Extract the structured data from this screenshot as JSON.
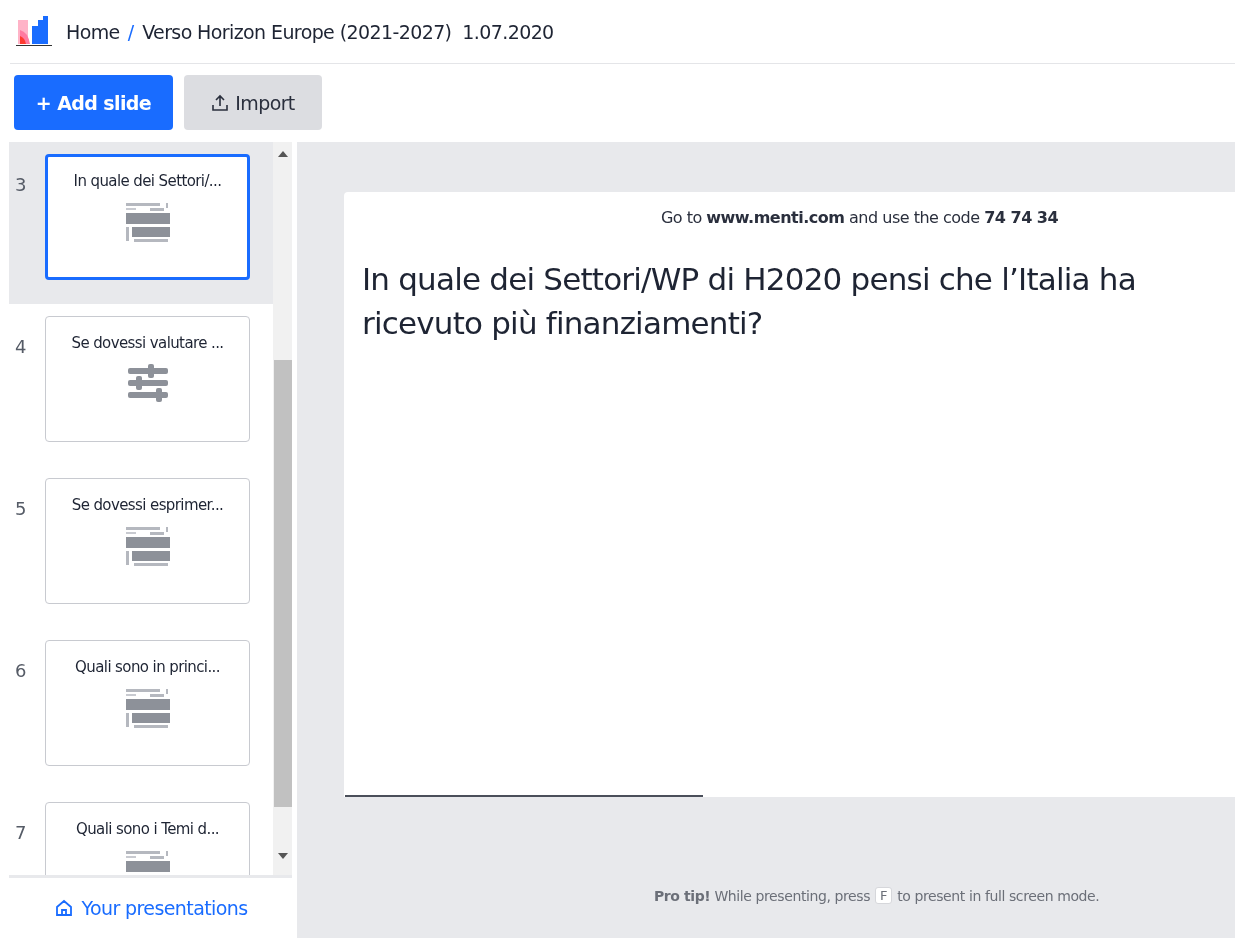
{
  "breadcrumb": {
    "home": "Home",
    "separator": "/",
    "title": "Verso Horizon Europe (2021-2027)  1.07.2020"
  },
  "toolbar": {
    "add_slide": "+ Add slide",
    "import": "Import"
  },
  "slides": [
    {
      "number": "3",
      "title": "In quale dei Settori/...",
      "kind": "wordcloud",
      "selected": true
    },
    {
      "number": "4",
      "title": "Se dovessi valutare ...",
      "kind": "scales",
      "selected": false
    },
    {
      "number": "5",
      "title": "Se dovessi esprimer...",
      "kind": "wordcloud",
      "selected": false
    },
    {
      "number": "6",
      "title": "Quali sono in princi...",
      "kind": "wordcloud",
      "selected": false
    },
    {
      "number": "7",
      "title": "Quali sono i Temi d...",
      "kind": "wordcloud",
      "selected": false
    }
  ],
  "sidebar_footer": {
    "label": "Your presentations"
  },
  "slide": {
    "instructions": "Go to **www.menti.com** and use the code **74 74 34**",
    "question": "In quale dei Settori/WP di H2020 pensi che l’Italia ha ricevuto più finanziamenti?"
  },
  "pro_tip": {
    "before": "**Pro tip!** While presenting, press",
    "key": "F",
    "after": "to present in full screen mode."
  }
}
